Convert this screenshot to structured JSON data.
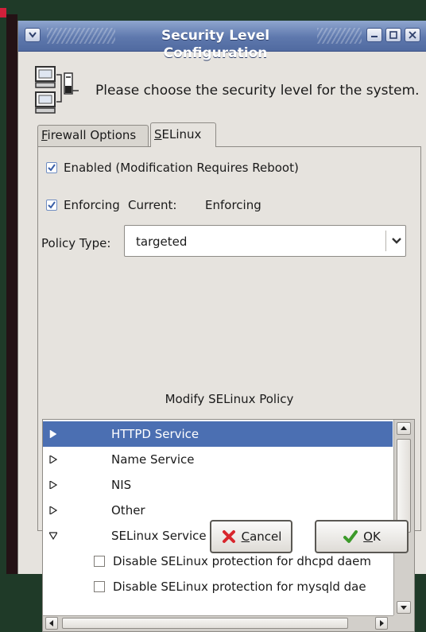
{
  "window": {
    "title": "Security Level Configuration"
  },
  "header": {
    "prompt": "Please choose the security level for the system."
  },
  "tabs": [
    {
      "label_first": "F",
      "label_rest": "irewall Options"
    },
    {
      "label_first": "S",
      "label_rest": "ELinux"
    }
  ],
  "selinux": {
    "enabled_label": "Enabled (Modification Requires Reboot)",
    "enabled_checked": true,
    "enforcing_label": "Enforcing",
    "current_label": "Current:",
    "current_value": "Enforcing",
    "enforcing_checked": true,
    "policy_type_label": "Policy Type:",
    "policy_type_value": "targeted",
    "modify_policy_title": "Modify SELinux Policy"
  },
  "policy_tree": {
    "items": [
      {
        "label": "HTTPD Service",
        "expanded": false,
        "selected": true
      },
      {
        "label": "Name Service",
        "expanded": false,
        "selected": false
      },
      {
        "label": "NIS",
        "expanded": false,
        "selected": false
      },
      {
        "label": "Other",
        "expanded": false,
        "selected": false
      },
      {
        "label": "SELinux Service Protection",
        "expanded": true,
        "selected": false
      }
    ],
    "children": [
      {
        "label": "Disable SELinux protection for dhcpd daem",
        "checked": false
      },
      {
        "label": "Disable SELinux protection for mysqld dae",
        "checked": false
      }
    ]
  },
  "buttons": {
    "cancel_first": "C",
    "cancel_rest": "ancel",
    "ok_first": "O",
    "ok_rest": "K"
  },
  "colors": {
    "titlebar": "#5e78ad",
    "selection": "#4b6fb2",
    "check_mark": "#3a5fa8",
    "cancel_icon": "#d8262d",
    "ok_icon": "#3c9a2a"
  },
  "icons": {
    "header": "network-computers-icon",
    "cancel": "x-icon",
    "ok": "checkmark-icon"
  }
}
